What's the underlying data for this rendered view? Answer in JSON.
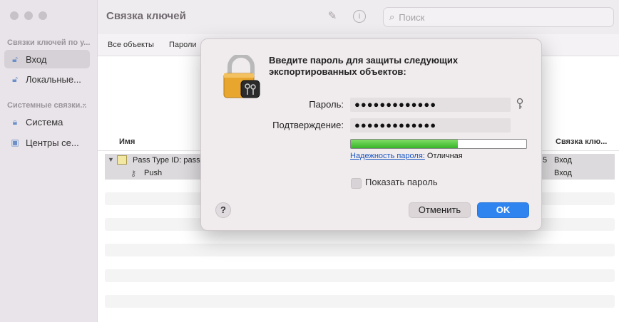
{
  "window": {
    "title": "Связка ключей"
  },
  "search": {
    "placeholder": "Поиск"
  },
  "sidebar": {
    "section1": "Связки ключей по у...",
    "items1": [
      {
        "label": "Вход"
      },
      {
        "label": "Локальные..."
      }
    ],
    "section2": "Системные связки...",
    "items2": [
      {
        "label": "Система"
      },
      {
        "label": "Центры се..."
      }
    ]
  },
  "tabs": [
    {
      "label": "Все объекты"
    },
    {
      "label": "Пароли"
    }
  ],
  "columns": {
    "name": "Имя",
    "keychain": "Связка клю..."
  },
  "rows": [
    {
      "name": "Pass Type ID: pass",
      "extra": "5",
      "keychain": "Вход"
    },
    {
      "name": "Push",
      "keychain": "Вход"
    }
  ],
  "dialog": {
    "title": "Введите пароль для защиты следующих экспортированных объектов:",
    "password_label": "Пароль:",
    "password_value": "●●●●●●●●●●●●●",
    "confirm_label": "Подтверждение:",
    "confirm_value": "●●●●●●●●●●●●●",
    "strength_fraction": 0.61,
    "strength_link": "Надежность пароля:",
    "strength_value": "Отличная",
    "show_password_label": "Показать пароль",
    "help_label": "?",
    "cancel_label": "Отменить",
    "ok_label": "OK"
  },
  "colors": {
    "accent": "#2f84f0",
    "meter_green": "#37b52a"
  }
}
